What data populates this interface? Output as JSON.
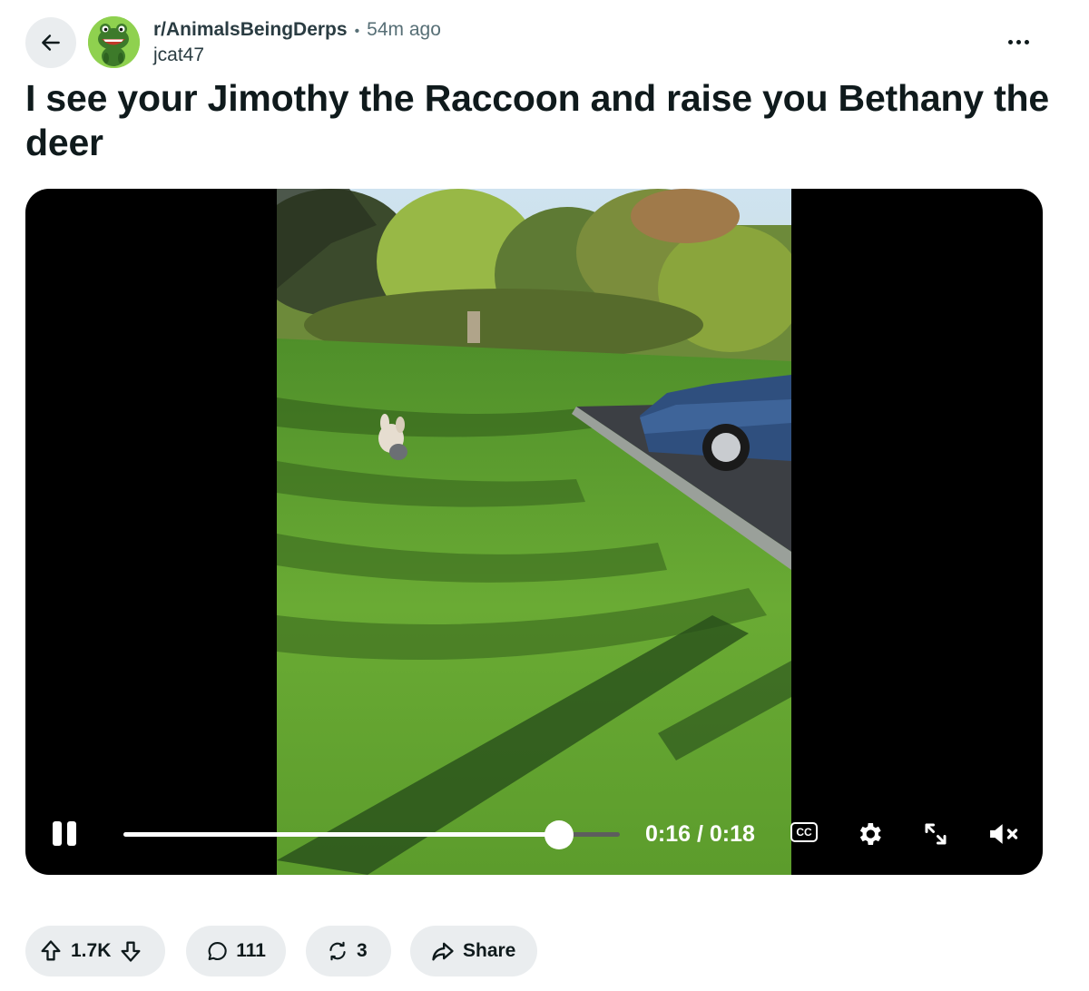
{
  "header": {
    "back_icon": "arrow-left-icon",
    "subreddit": "r/AnimalsBeingDerps",
    "separator": "•",
    "time_ago": "54m ago",
    "username": "jcat47",
    "more_icon": "ellipsis-icon"
  },
  "post": {
    "title": "I see your Jimothy the Raccoon and raise you Bethany the deer"
  },
  "video": {
    "current_time": "0:16",
    "duration": "0:18",
    "timecode": "0:16 / 0:18",
    "progress": 0.877,
    "cc_label": "CC",
    "icons": [
      "pause-icon",
      "cc-icon",
      "settings-gear-icon",
      "fullscreen-icon",
      "muted-speaker-icon"
    ]
  },
  "actions": {
    "votes": "1.7K",
    "comments": "111",
    "crossposts": "3",
    "share_label": "Share"
  },
  "colors": {
    "pill_bg": "#eaedef",
    "text": "#0f1a1c",
    "meta": "#576f76",
    "avatar_green": "#8fd14f"
  }
}
